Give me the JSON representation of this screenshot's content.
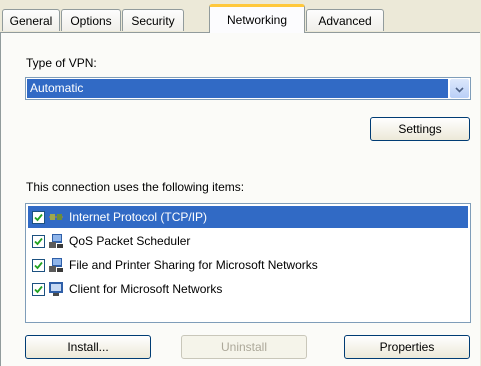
{
  "tabs": [
    {
      "label": "General",
      "active": false
    },
    {
      "label": "Options",
      "active": false
    },
    {
      "label": "Security",
      "active": false
    },
    {
      "label": "Networking",
      "active": true
    },
    {
      "label": "Advanced",
      "active": false
    }
  ],
  "vpn": {
    "type_label": "Type of VPN:",
    "selected": "Automatic",
    "settings_label": "Settings"
  },
  "items": {
    "label": "This connection uses the following items:",
    "list": [
      {
        "label": "Internet Protocol (TCP/IP)",
        "checked": true,
        "selected": true,
        "icon": "network-protocol-icon"
      },
      {
        "label": "QoS Packet Scheduler",
        "checked": true,
        "selected": false,
        "icon": "network-service-icon"
      },
      {
        "label": "File and Printer Sharing for Microsoft Networks",
        "checked": true,
        "selected": false,
        "icon": "network-service-icon"
      },
      {
        "label": "Client for Microsoft Networks",
        "checked": true,
        "selected": false,
        "icon": "network-client-icon"
      }
    ]
  },
  "buttons": {
    "install": "Install...",
    "uninstall": "Uninstall",
    "properties": "Properties"
  },
  "colors": {
    "selection": "#316ac5",
    "active_tab_highlight": "#ffc83c",
    "dialog_bg": "#ece9d8"
  }
}
